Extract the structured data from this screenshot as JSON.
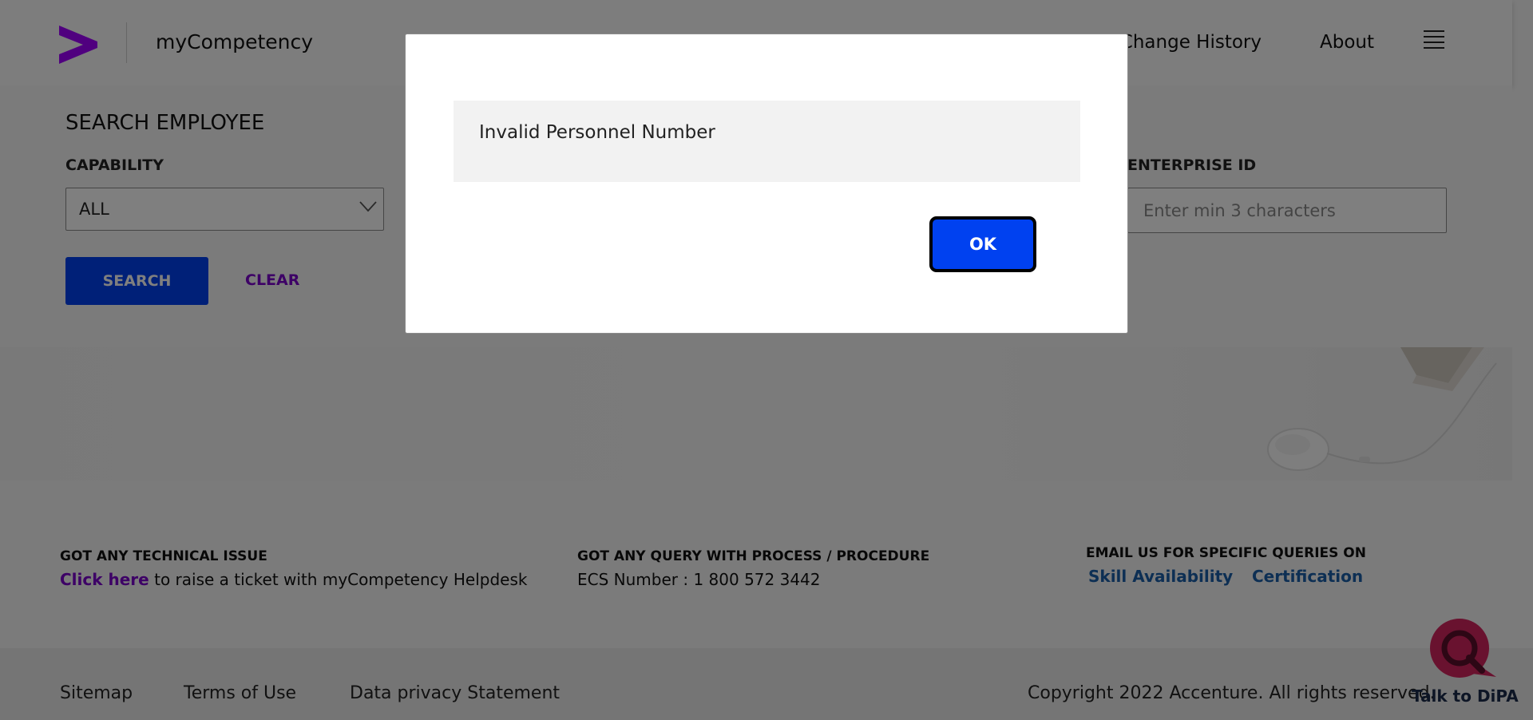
{
  "header": {
    "app_title": "myCompetency",
    "nav": {
      "change_history": "l Change History",
      "about": "About"
    }
  },
  "search": {
    "title": "SEARCH EMPLOYEE",
    "capability_label": "CAPABILITY",
    "capability_value": "ALL",
    "enterprise_label": "ENTERPRISE ID",
    "enterprise_placeholder": "Enter min 3 characters",
    "search_button": "SEARCH",
    "clear_button": "CLEAR"
  },
  "footer_info": {
    "technical": {
      "heading": "GOT ANY TECHNICAL ISSUE",
      "link": "Click here",
      "text": " to raise a ticket with myCompetency Helpdesk"
    },
    "query": {
      "heading": "GOT ANY QUERY WITH PROCESS / PROCEDURE",
      "text": "ECS Number : 1 800 572 3442"
    },
    "email": {
      "heading": "EMAIL US FOR SPECIFIC QUERIES ON",
      "link_1": "Skill Availability",
      "link_2": "Certification"
    }
  },
  "bottom_footer": {
    "sitemap": "Sitemap",
    "terms": "Terms of Use",
    "privacy": "Data privacy Statement",
    "copyright": "Copyright 2022 Accenture. All rights reserved."
  },
  "chatbot": {
    "label": "Talk to DiPA"
  },
  "modal": {
    "message": "Invalid Personnel Number",
    "ok_button": "OK"
  },
  "colors": {
    "brand_purple": "#a100ff",
    "primary_blue": "#0041f0",
    "link_purple": "#7a00cc",
    "link_blue": "#1a5fa8",
    "dipa_pink": "#d2245e"
  },
  "icons": {
    "logo": "accenture-arrow-logo",
    "menu": "hamburger-icon",
    "dropdown": "chevron-down-icon",
    "chatbot": "chat-bubble-icon"
  }
}
